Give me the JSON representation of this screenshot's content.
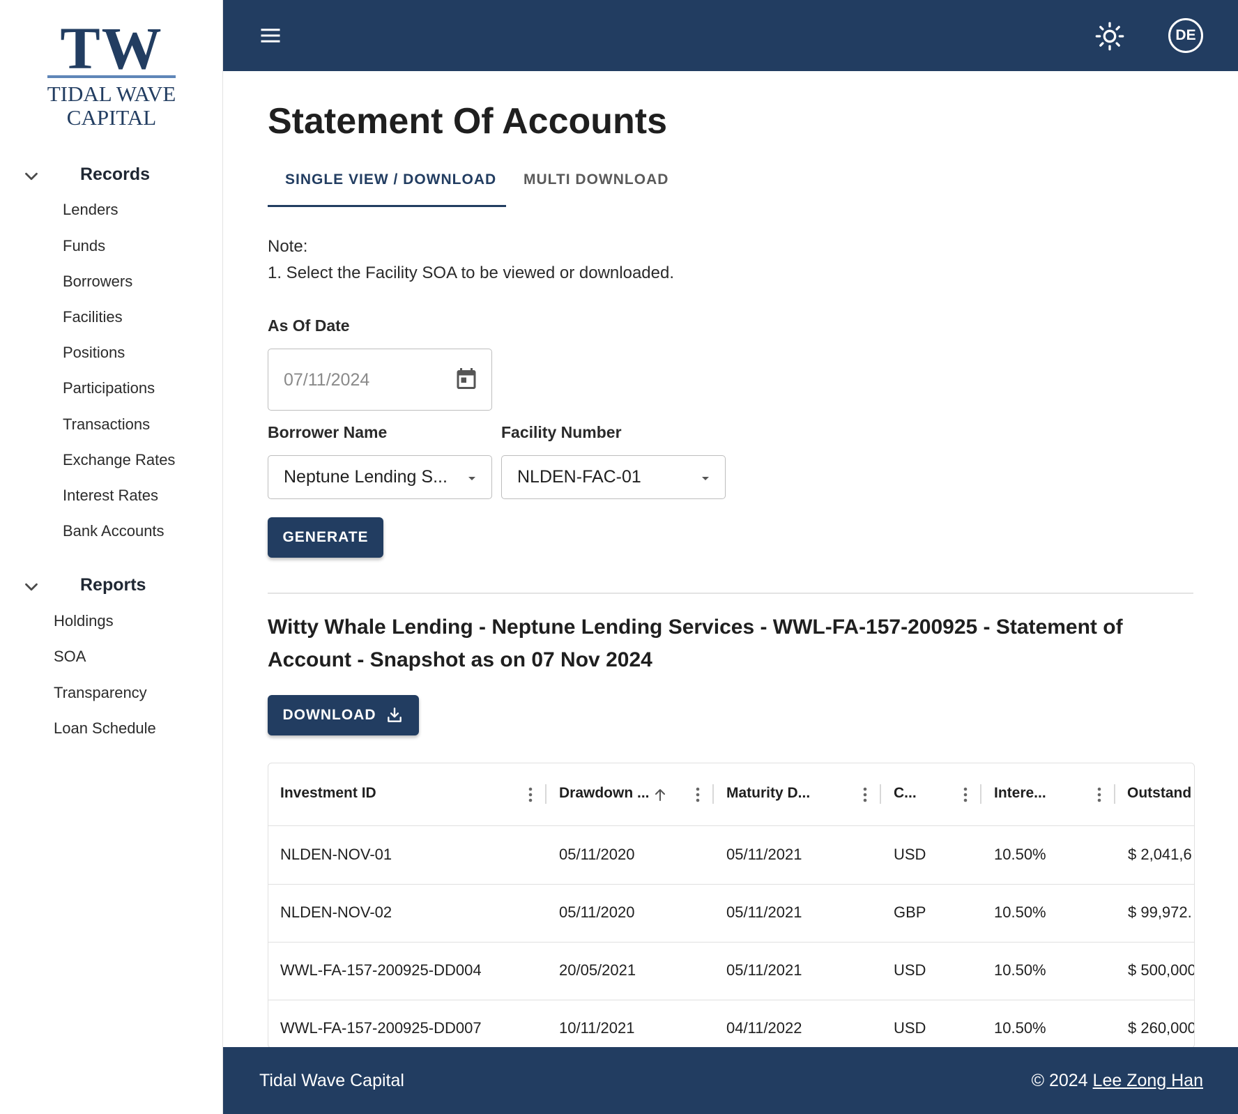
{
  "brand": {
    "logo_mark": "TW",
    "logo_line1": "TIDAL WAVE",
    "logo_line2": "CAPITAL"
  },
  "sidebar": {
    "records": {
      "title": "Records",
      "items": [
        "Lenders",
        "Funds",
        "Borrowers",
        "Facilities",
        "Positions",
        "Participations",
        "Transactions",
        "Exchange Rates",
        "Interest Rates",
        "Bank Accounts"
      ]
    },
    "reports": {
      "title": "Reports",
      "items": [
        "Holdings",
        "SOA",
        "Transparency",
        "Loan Schedule"
      ]
    }
  },
  "header": {
    "avatar_initials": "DE",
    "icons": [
      "menu-icon",
      "sun-icon"
    ]
  },
  "main": {
    "title": "Statement Of Accounts",
    "tabs": [
      {
        "label": "SINGLE VIEW / DOWNLOAD",
        "active": true
      },
      {
        "label": "MULTI DOWNLOAD",
        "active": false
      }
    ],
    "note_heading": "Note:",
    "note_line": "1. Select the Facility SOA to be viewed or downloaded.",
    "as_of_date": {
      "label": "As Of Date",
      "value": "07/11/2024"
    },
    "borrower": {
      "label": "Borrower Name",
      "value": "Neptune Lending S..."
    },
    "facility": {
      "label": "Facility Number",
      "value": "NLDEN-FAC-01"
    },
    "generate_label": "GENERATE",
    "report_title": "Witty Whale Lending - Neptune Lending Services - WWL-FA-157-200925 - Statement of Account - Snapshot as on 07 Nov 2024",
    "download_label": "DOWNLOAD"
  },
  "table": {
    "columns": [
      "Investment ID",
      "Drawdown ...",
      "Maturity D...",
      "C...",
      "Intere...",
      "Outstand"
    ],
    "rows": [
      [
        "NLDEN-NOV-01",
        "05/11/2020",
        "05/11/2021",
        "USD",
        "10.50%",
        "$ 2,041,6"
      ],
      [
        "NLDEN-NOV-02",
        "05/11/2020",
        "05/11/2021",
        "GBP",
        "10.50%",
        "$ 99,972."
      ],
      [
        "WWL-FA-157-200925-DD004",
        "20/05/2021",
        "05/11/2021",
        "USD",
        "10.50%",
        "$ 500,000"
      ],
      [
        "WWL-FA-157-200925-DD007",
        "10/11/2021",
        "04/11/2022",
        "USD",
        "10.50%",
        "$ 260,000"
      ]
    ]
  },
  "footer": {
    "left": "Tidal Wave Capital",
    "copyright": "© 2024",
    "author": "Lee Zong Han"
  },
  "colors": {
    "primary": "#223d61",
    "logo_accent": "#5f86b8"
  }
}
